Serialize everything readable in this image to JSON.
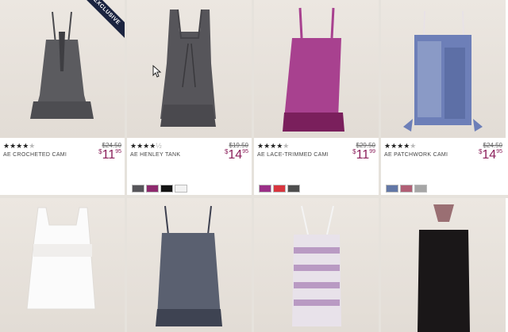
{
  "products": [
    {
      "name": "AE CROCHETED CAMI",
      "rating": 4,
      "was": "$24.50",
      "currency": "$",
      "dollars": "11",
      "cents": "95",
      "badge": "EXCLUSIVE",
      "swatches": [],
      "color": "#5b5b5f"
    },
    {
      "name": "AE HENLEY TANK",
      "rating": 4.5,
      "was": "$19.50",
      "currency": "$",
      "dollars": "14",
      "cents": "95",
      "badge": "",
      "swatches": [
        "#56555a",
        "#8e2a6e",
        "#141414",
        "#f2f2f2"
      ],
      "color": "#56555a"
    },
    {
      "name": "AE LACE-TRIMMED CAMI",
      "rating": 4,
      "was": "$29.50",
      "currency": "$",
      "dollars": "11",
      "cents": "99",
      "badge": "",
      "swatches": [
        "#9a2f87",
        "#d8353e",
        "#4e4e4e"
      ],
      "color": "#a8418f"
    },
    {
      "name": "AE PATCHWORK CAMI",
      "rating": 4,
      "was": "$24.50",
      "currency": "$",
      "dollars": "14",
      "cents": "95",
      "badge": "",
      "swatches": [
        "#6277a6",
        "#b05f75",
        "#a6a6a6"
      ],
      "color": "#6d7fb8"
    },
    {
      "name": "",
      "rating": 0,
      "was": "",
      "currency": "",
      "dollars": "",
      "cents": "",
      "badge": "",
      "swatches": [],
      "color": "#fbfbfb"
    },
    {
      "name": "",
      "rating": 0,
      "was": "",
      "currency": "",
      "dollars": "",
      "cents": "",
      "badge": "",
      "swatches": [],
      "color": "#5a6070"
    },
    {
      "name": "",
      "rating": 0,
      "was": "",
      "currency": "",
      "dollars": "",
      "cents": "",
      "badge": "",
      "swatches": [],
      "color": "#d9c9de"
    },
    {
      "name": "",
      "rating": 0,
      "was": "",
      "currency": "",
      "dollars": "",
      "cents": "",
      "badge": "",
      "swatches": [],
      "color": "#1a1718"
    }
  ]
}
